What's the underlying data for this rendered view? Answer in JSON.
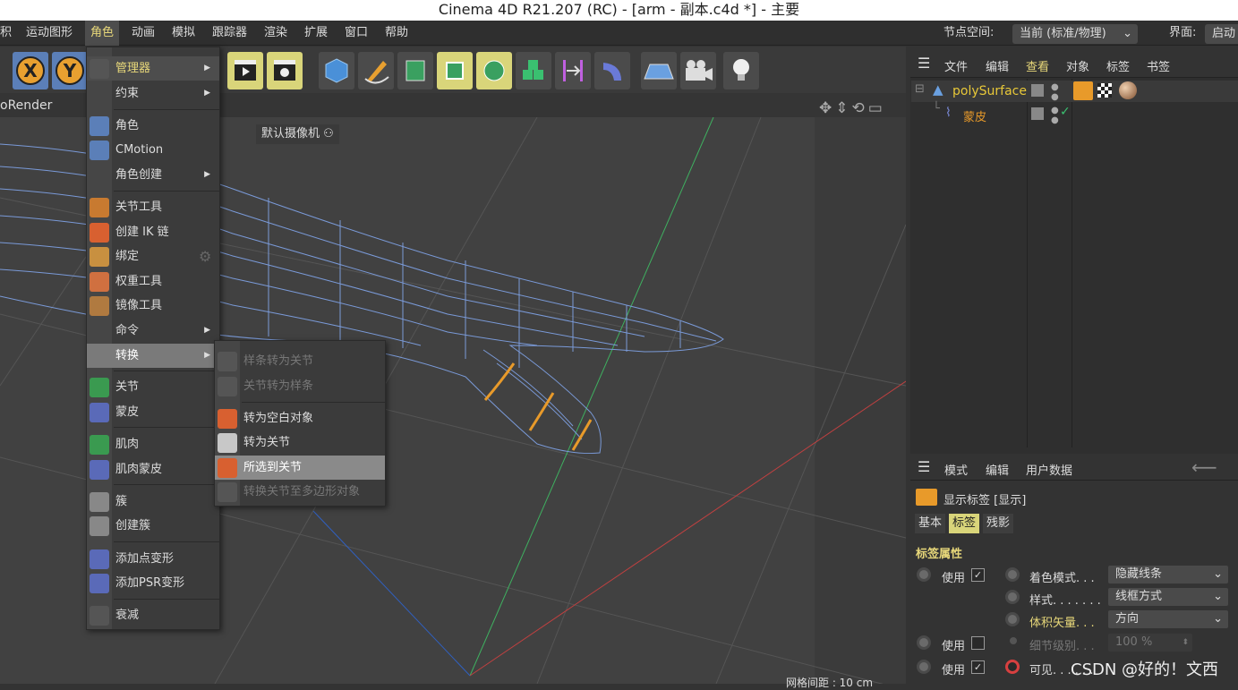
{
  "window": {
    "title": "Cinema 4D R21.207 (RC) - [arm - 副本.c4d *] - 主要"
  },
  "menubar": {
    "items": [
      "积",
      "运动图形",
      "角色",
      "动画",
      "模拟",
      "跟踪器",
      "渲染",
      "扩展",
      "窗口",
      "帮助"
    ],
    "node_space_label": "节点空间:",
    "node_space_value": "当前 (标准/物理)",
    "layout_label": "界面:",
    "layout_value": "启动"
  },
  "toolbar": {
    "prorender": "oRender",
    "x_btn": "X",
    "y_btn": "Y"
  },
  "viewport": {
    "camera_label": "默认摄像机",
    "grid_label": "网格间距 : 10 cm"
  },
  "char_menu": {
    "items": [
      {
        "label": "管理器",
        "arrow": "▶"
      },
      {
        "label": "约束",
        "arrow": "▶"
      },
      {
        "label": "角色"
      },
      {
        "label": "CMotion"
      },
      {
        "label": "角色创建",
        "arrow": "▶"
      },
      {
        "label": "关节工具"
      },
      {
        "label": "创建 IK 链"
      },
      {
        "label": "绑定"
      },
      {
        "label": "权重工具"
      },
      {
        "label": "镜像工具"
      },
      {
        "label": "命令",
        "arrow": "▶"
      },
      {
        "label": "转换",
        "arrow": "▶"
      },
      {
        "label": "关节"
      },
      {
        "label": "蒙皮"
      },
      {
        "label": "肌肉"
      },
      {
        "label": "肌肉蒙皮"
      },
      {
        "label": "簇"
      },
      {
        "label": "创建簇"
      },
      {
        "label": "添加点变形"
      },
      {
        "label": "添加PSR变形"
      },
      {
        "label": "衰减"
      }
    ]
  },
  "convert_menu": {
    "items": [
      {
        "label": "样条转为关节"
      },
      {
        "label": "关节转为样条"
      },
      {
        "label": "转为空白对象"
      },
      {
        "label": "转为关节"
      },
      {
        "label": "所选到关节"
      },
      {
        "label": "转换关节至多边形对象"
      }
    ]
  },
  "objects": {
    "menu": [
      "文件",
      "编辑",
      "查看",
      "对象",
      "标签",
      "书签"
    ],
    "items": [
      {
        "name": "polySurface"
      },
      {
        "name": "蒙皮"
      }
    ]
  },
  "attributes": {
    "menu": [
      "模式",
      "编辑",
      "用户数据"
    ],
    "tag_title": "显示标签 [显示]",
    "tabs": [
      "基本",
      "标签",
      "残影"
    ],
    "section": "标签属性",
    "use_label": "使用",
    "shading_label": "着色模式. . .",
    "shading_value": "隐藏线条",
    "style_label": "样式. . . . . . .",
    "style_value": "线框方式",
    "backface_label": "体积矢量. . .",
    "backface_value": "方向",
    "lod_label": "细节级别. . .",
    "lod_value": "100 %",
    "visible_label": "可见. . . . . .",
    "watermark": "CSDN @好的！文西"
  },
  "colors": {
    "accent": "#e8d87a",
    "orange": "#e89a2a",
    "mesh": "#7a9ad8"
  }
}
